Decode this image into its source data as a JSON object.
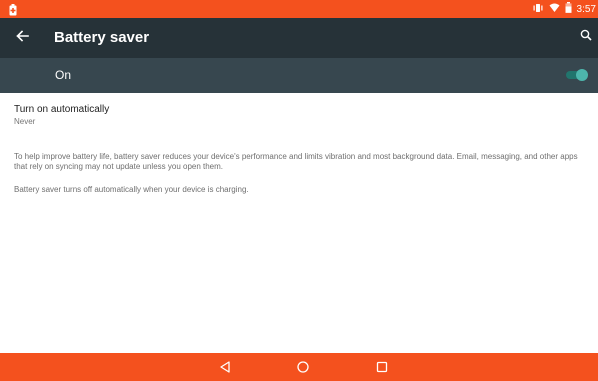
{
  "status_bar": {
    "time": "3:57",
    "icons": [
      "battery-saver-icon",
      "vibrate-icon",
      "wifi-icon",
      "battery-icon"
    ],
    "color": "#f4511e"
  },
  "toolbar": {
    "title": "Battery saver",
    "back_icon": "arrow-back-icon",
    "search_icon": "search-icon",
    "color": "#263238"
  },
  "master_switch": {
    "label": "On",
    "state": true,
    "color": "#37474f",
    "accent": "#4db6ac"
  },
  "settings": {
    "auto_on": {
      "title": "Turn on automatically",
      "value": "Never"
    },
    "description_1": "To help improve battery life, battery saver reduces your device's performance and limits vibration and most background data. Email, messaging, and other apps that rely on syncing may not update unless you open them.",
    "description_2": "Battery saver turns off automatically when your device is charging."
  },
  "nav_bar": {
    "icons": [
      "nav-back-icon",
      "nav-home-icon",
      "nav-recents-icon"
    ],
    "color": "#f4511e"
  }
}
